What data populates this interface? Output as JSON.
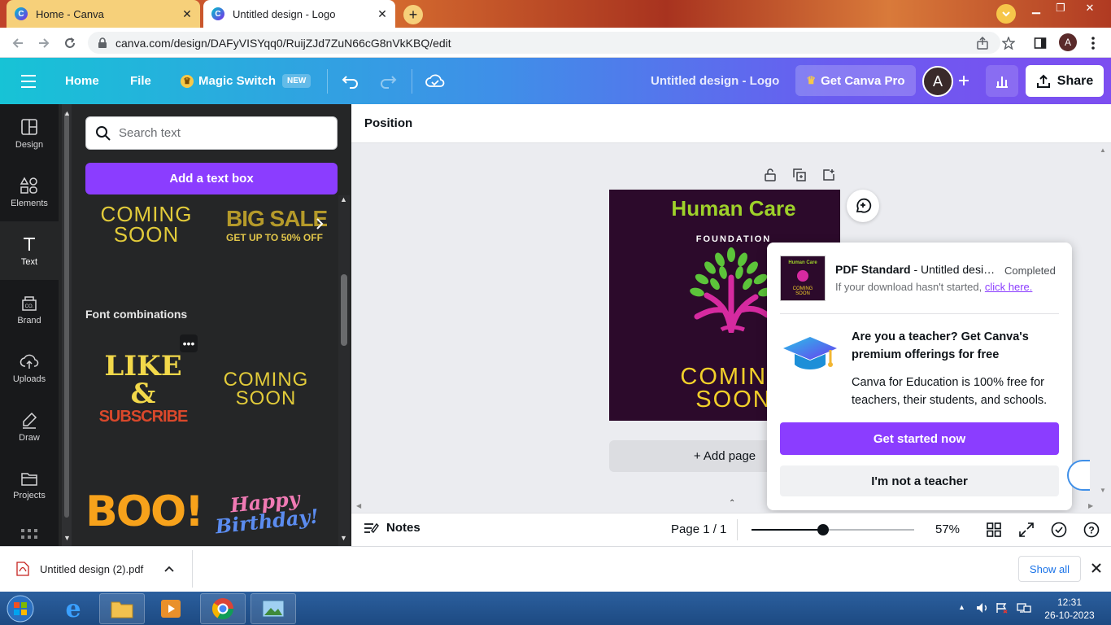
{
  "browser": {
    "tabs": [
      {
        "title": "Home - Canva",
        "active": false
      },
      {
        "title": "Untitled design - Logo",
        "active": true
      }
    ],
    "url": "canva.com/design/DAFyVISYqq0/RuijZJd7ZuN66cG8nVkKBQ/edit",
    "profile_initial": "A"
  },
  "header": {
    "home": "Home",
    "file": "File",
    "magic_switch": "Magic Switch",
    "new_badge": "NEW",
    "doc_title": "Untitled design - Logo",
    "get_pro": "Get Canva Pro",
    "avatar_initial": "A",
    "share": "Share"
  },
  "rail": {
    "items": [
      {
        "label": "Design",
        "icon": "design-icon"
      },
      {
        "label": "Elements",
        "icon": "elements-icon"
      },
      {
        "label": "Text",
        "icon": "text-icon",
        "active": true
      },
      {
        "label": "Brand",
        "icon": "brand-icon"
      },
      {
        "label": "Uploads",
        "icon": "uploads-icon"
      },
      {
        "label": "Draw",
        "icon": "draw-icon"
      },
      {
        "label": "Projects",
        "icon": "projects-icon"
      }
    ]
  },
  "panel": {
    "search_placeholder": "Search text",
    "add_text_box": "Add a text box",
    "top_tiles": [
      {
        "line1": "COMING",
        "line2": "SOON"
      },
      {
        "line1": "BIG SALE",
        "line2": "GET UP TO 50% OFF"
      }
    ],
    "section_title": "Font combinations",
    "combos": [
      {
        "line1": "LIKE &",
        "line2": "SUBSCRIBE"
      },
      {
        "line1": "COMING",
        "line2": "SOON"
      },
      {
        "line1": "BOO!",
        "line2": ""
      },
      {
        "line1": "Happy",
        "line2": "Birthday!"
      }
    ]
  },
  "canvas": {
    "position_label": "Position",
    "design": {
      "title": "Human Care",
      "subtitle": "FOUNDATION",
      "line1": "COMING",
      "line2": "SOON"
    },
    "add_page": "+ Add page"
  },
  "popup": {
    "file_type": "PDF Standard",
    "file_name": "- Untitled design - Logo",
    "status": "Completed",
    "hint_prefix": "If your download hasn't started, ",
    "hint_link": "click here.",
    "teacher_heading": "Are you a teacher? Get Canva's premium offerings for free",
    "teacher_body": "Canva for Education is 100% free for teachers, their students, and schools.",
    "get_started": "Get started now",
    "not_teacher": "I'm not a teacher"
  },
  "bottom": {
    "notes": "Notes",
    "page_info": "Page 1 / 1",
    "zoom_label": "57%",
    "zoom_fraction": 0.44
  },
  "download_shelf": {
    "file_name": "Untitled design (2).pdf",
    "show_all": "Show all"
  },
  "taskbar": {
    "time": "12:31",
    "date": "26-10-2023"
  },
  "colors": {
    "accent_purple": "#8b3dff",
    "design_bg": "#2c0a2b",
    "design_title": "#9ed12a",
    "design_text": "#f2d02a"
  }
}
